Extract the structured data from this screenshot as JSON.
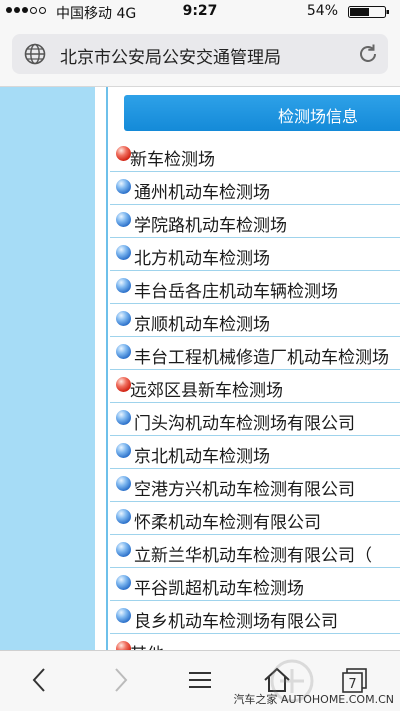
{
  "status_bar": {
    "carrier": "中国移动 4G",
    "time": "9:27",
    "battery": "54%"
  },
  "url_bar": {
    "title": "北京市公安局公安交通管理局"
  },
  "header": {
    "title": "检测场信息"
  },
  "stations": [
    {
      "label": "新车检测场",
      "marker": "red"
    },
    {
      "label": "通州机动车检测场",
      "marker": "blue"
    },
    {
      "label": "学院路机动车检测场",
      "marker": "blue"
    },
    {
      "label": "北方机动车检测场",
      "marker": "blue"
    },
    {
      "label": "丰台岳各庄机动车辆检测场",
      "marker": "blue"
    },
    {
      "label": "京顺机动车检测场",
      "marker": "blue"
    },
    {
      "label": "丰台工程机械修造厂机动车检测场",
      "marker": "blue"
    },
    {
      "label": "远郊区县新车检测场",
      "marker": "red"
    },
    {
      "label": "门头沟机动车检测场有限公司",
      "marker": "blue"
    },
    {
      "label": "京北机动车检测场",
      "marker": "blue"
    },
    {
      "label": "空港方兴机动车检测有限公司",
      "marker": "blue"
    },
    {
      "label": "怀柔机动车检测有限公司",
      "marker": "blue"
    },
    {
      "label": "立新兰华机动车检测有限公司（",
      "marker": "blue"
    },
    {
      "label": "平谷凯超机动车检测场",
      "marker": "blue"
    },
    {
      "label": "良乡机动车检测场有限公司",
      "marker": "blue"
    },
    {
      "label": "其他",
      "marker": "red"
    }
  ],
  "toolbar": {
    "tabs_count": "7",
    "watermark": "汽车之家 AUTOHOME.COM.CN"
  },
  "colors": {
    "header_blue": "#1a8fdc",
    "side_panel": "#a6dcf6",
    "row_border": "#9fd3ec"
  }
}
